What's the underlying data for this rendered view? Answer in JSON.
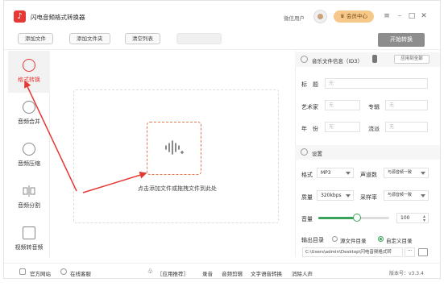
{
  "app": {
    "title": "闪电音频格式转换器"
  },
  "header": {
    "user_label": "微信用户",
    "vip_label": "会员中心",
    "menu_icon": "menu-icon",
    "min_icon": "minimize-icon",
    "max_icon": "maximize-icon",
    "close_icon": "close-icon"
  },
  "toolbar": {
    "add_file": "添加文件",
    "add_folder": "添加文件夹",
    "clear_list": "清空列表",
    "start": "开始转换"
  },
  "sidebar": {
    "items": [
      {
        "label": "格式转换",
        "icon": "refresh-icon",
        "active": true
      },
      {
        "label": "音频合并",
        "icon": "merge-icon"
      },
      {
        "label": "音频压缩",
        "icon": "compress-icon"
      },
      {
        "label": "音频分割",
        "icon": "split-icon"
      },
      {
        "label": "视频转音频",
        "icon": "video-icon"
      }
    ]
  },
  "drop": {
    "text": "点击添加文件或拖拽文件到此处"
  },
  "id3": {
    "header": "音乐文件信息（ID3）",
    "apply_all": "应用到全部",
    "title_label": "标　题",
    "artist_label": "艺术家",
    "album_label": "专辑",
    "year_label": "年　份",
    "genre_label": "流派",
    "placeholder": "无"
  },
  "settings": {
    "header": "设置",
    "format_label": "格式",
    "format_value": "MP3",
    "channels_label": "声道数",
    "channels_value": "与源音频一致",
    "quality_label": "质量",
    "quality_value": "320kbps",
    "samplerate_label": "采样率",
    "samplerate_value": "与源音频一致",
    "volume_label": "音量",
    "volume_value": "100",
    "volume_fraction": 0.5,
    "output_label": "输出目录",
    "output_source": "源文件目录",
    "output_custom": "自定义目录",
    "output_path": "C:\\Users\\admin\\Desktop\\闪电音频格式转",
    "dots": "···"
  },
  "statusbar": {
    "website": "官方网站",
    "support": "在线客服",
    "recommend": "［应用推荐］",
    "links": [
      "录音",
      "音频剪辑",
      "文字语音转换",
      "消除人声"
    ],
    "version": "版本号：v3.3.4"
  },
  "colors": {
    "accent": "#e53935",
    "green": "#3aa35a",
    "vip": "#f6c98a"
  }
}
